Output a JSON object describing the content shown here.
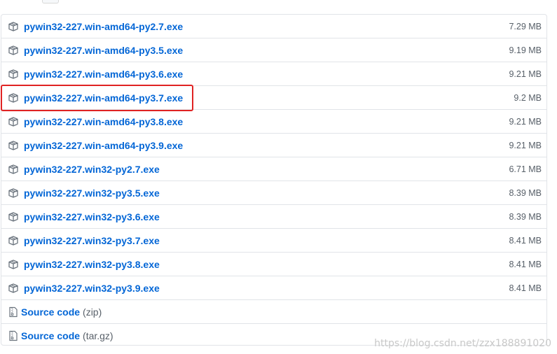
{
  "assets": [
    {
      "name": "pywin32-227.win-amd64-py2.7.exe",
      "size": "7.29 MB",
      "icon": "package-icon"
    },
    {
      "name": "pywin32-227.win-amd64-py3.5.exe",
      "size": "9.19 MB",
      "icon": "package-icon"
    },
    {
      "name": "pywin32-227.win-amd64-py3.6.exe",
      "size": "9.21 MB",
      "icon": "package-icon"
    },
    {
      "name": "pywin32-227.win-amd64-py3.7.exe",
      "size": "9.2 MB",
      "icon": "package-icon",
      "highlighted": true
    },
    {
      "name": "pywin32-227.win-amd64-py3.8.exe",
      "size": "9.21 MB",
      "icon": "package-icon"
    },
    {
      "name": "pywin32-227.win-amd64-py3.9.exe",
      "size": "9.21 MB",
      "icon": "package-icon"
    },
    {
      "name": "pywin32-227.win32-py2.7.exe",
      "size": "6.71 MB",
      "icon": "package-icon"
    },
    {
      "name": "pywin32-227.win32-py3.5.exe",
      "size": "8.39 MB",
      "icon": "package-icon"
    },
    {
      "name": "pywin32-227.win32-py3.6.exe",
      "size": "8.39 MB",
      "icon": "package-icon"
    },
    {
      "name": "pywin32-227.win32-py3.7.exe",
      "size": "8.41 MB",
      "icon": "package-icon"
    },
    {
      "name": "pywin32-227.win32-py3.8.exe",
      "size": "8.41 MB",
      "icon": "package-icon"
    },
    {
      "name": "pywin32-227.win32-py3.9.exe",
      "size": "8.41 MB",
      "icon": "package-icon"
    }
  ],
  "source": [
    {
      "label": "Source code",
      "format": "(zip)",
      "icon": "file-zip-icon"
    },
    {
      "label": "Source code",
      "format": "(tar.gz)",
      "icon": "file-zip-icon"
    }
  ],
  "watermark": "https://blog.csdn.net/zzx188891020",
  "colors": {
    "link": "#0366d6",
    "muted": "#586069",
    "border": "#e1e4e8",
    "highlight": "#e02323"
  }
}
